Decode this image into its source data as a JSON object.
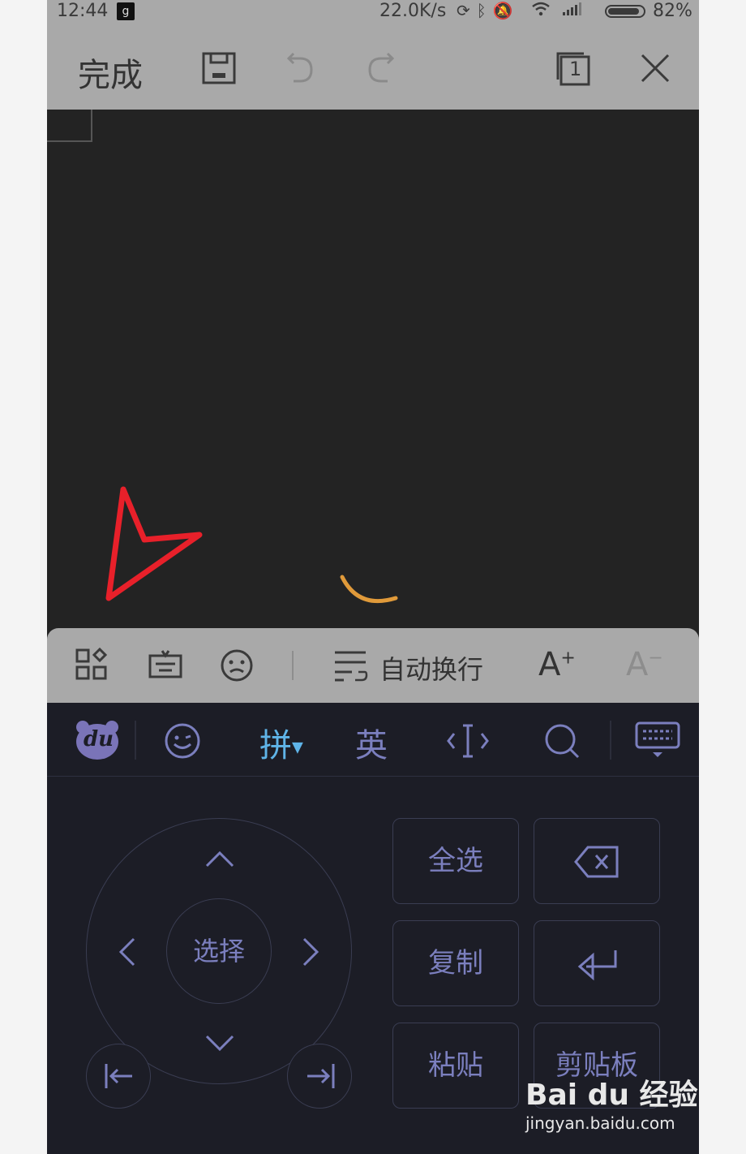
{
  "status_bar": {
    "time": "12:44",
    "notification_badge": "g",
    "net_speed": "22.0K/s",
    "battery_percent": "82%",
    "icons": [
      "sync-icon",
      "bluetooth-icon",
      "mute-icon",
      "wifi-icon",
      "signal-icon",
      "battery-icon"
    ]
  },
  "toolbar": {
    "done_label": "完成",
    "page_badge": "1",
    "icons": [
      "save-icon",
      "undo-icon",
      "redo-icon",
      "pages-icon",
      "close-icon"
    ]
  },
  "edit_tools": {
    "wrap_label": "自动换行",
    "font_increase": "A",
    "font_decrease": "A"
  },
  "keyboard": {
    "brand": "du",
    "pinyin": "拼",
    "english": "英",
    "select_center": "选择",
    "keys": {
      "select_all": "全选",
      "copy": "复制",
      "paste": "粘贴",
      "clipboard": "剪贴板"
    }
  },
  "watermark": {
    "brand": "Bai du 经验",
    "url": "jingyan.baidu.com"
  },
  "colors": {
    "toolbar_bg": "#a9a9a9",
    "editor_bg": "#232323",
    "keyboard_bg": "#1c1d26",
    "key_text": "#7b7fbe",
    "pinyin_active": "#5fb4e8",
    "annotation_arrow": "#e8202a",
    "spinner": "#e09a3a"
  }
}
